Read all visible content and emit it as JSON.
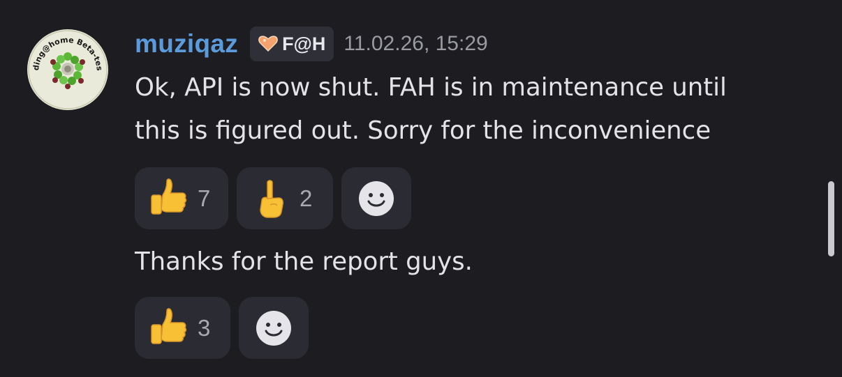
{
  "message": {
    "username": "muziqaz",
    "tag": {
      "label": "F@H",
      "icon": "heart-icon"
    },
    "timestamp": "11.02.26, 15:29",
    "avatar": {
      "text_top": "Folding@home Beta-tester",
      "icon": "folding-at-home-badge"
    },
    "lines": [
      "Ok, API is now shut. FAH is in maintenance until",
      "this is figured out. Sorry for the inconvenience"
    ],
    "reactions": [
      {
        "emoji": "thumbs-up-icon",
        "count": "7"
      },
      {
        "emoji": "index-pointing-up-icon",
        "count": "2"
      },
      {
        "emoji": "add-reaction-icon",
        "count": null
      }
    ]
  },
  "message2": {
    "text": "Thanks for the report guys.",
    "reactions": [
      {
        "emoji": "thumbs-up-icon",
        "count": "3"
      },
      {
        "emoji": "add-reaction-icon",
        "count": null
      }
    ]
  },
  "colors": {
    "background": "#1c1c21",
    "username": "#5b9bdb",
    "reaction_bg": "#2b2c33",
    "tag_bg": "#2e2f37",
    "timestamp": "#9a9aa3"
  }
}
